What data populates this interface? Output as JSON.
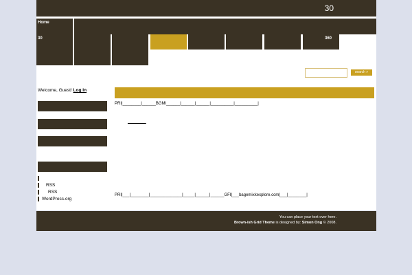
{
  "site": {
    "title": "30"
  },
  "nav": {
    "home_label": "Home",
    "item_30_label": "30",
    "item_360_label": "360"
  },
  "search": {
    "button_label": "search »",
    "value": ""
  },
  "sidebar": {
    "welcome_text": "Welcome, Guest!",
    "login_label": "Log In",
    "links": [
      {
        "label": "RSS"
      },
      {
        "label": "RSS"
      },
      {
        "label": "WordPress.org"
      }
    ]
  },
  "main": {
    "post_line_1": "PRI|________|______BGMI______|______|______|__________|__________|",
    "post_link": "________",
    "post_line_2": "PRI|___|________|______________|_____|______|______GFI|___bagemixkexplore.com|___|________|"
  },
  "footer": {
    "line1": "You can place your text over here.",
    "theme_name": "Brown-ish Grid Theme",
    "designed_by": "is designed by:",
    "author": "Simon Ong",
    "copyright": "© 2008."
  },
  "colors": {
    "brown": "#3a3224",
    "gold": "#c9a020",
    "background": "#dce0ec"
  }
}
